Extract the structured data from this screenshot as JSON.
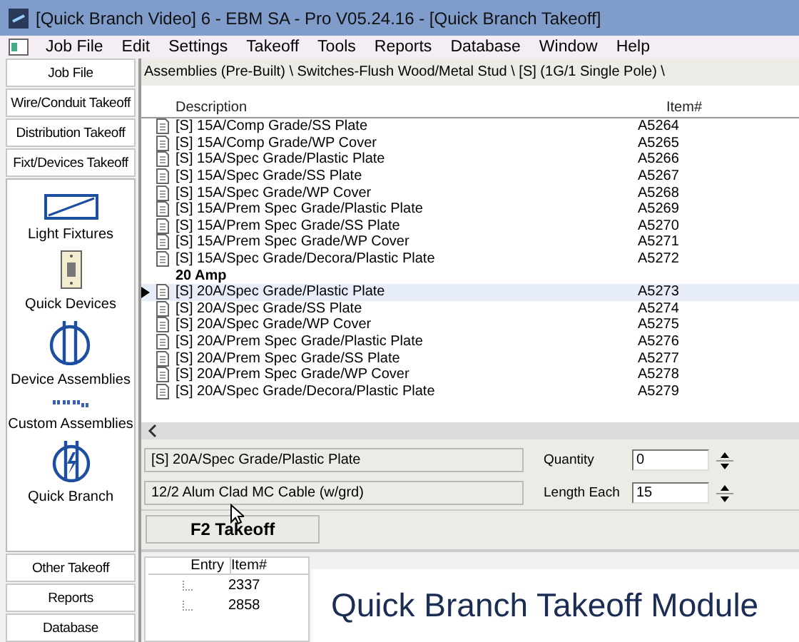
{
  "window": {
    "title": "[Quick Branch Video] 6 - EBM SA  - Pro V05.24.16 - [Quick Branch Takeoff]"
  },
  "menu": [
    "Job File",
    "Edit",
    "Settings",
    "Takeoff",
    "Tools",
    "Reports",
    "Database",
    "Window",
    "Help"
  ],
  "sidebar": {
    "top_buttons": [
      "Job File",
      "Wire/Conduit Takeoff",
      "Distribution Takeoff",
      "Fixt/Devices Takeoff"
    ],
    "tools": [
      {
        "kind": "fixture",
        "label": "Light Fixtures"
      },
      {
        "kind": "device",
        "label": "Quick Devices"
      },
      {
        "kind": "assembly",
        "label": "Device Assemblies"
      },
      {
        "kind": "custom",
        "label": "Custom Assemblies"
      },
      {
        "kind": "branch",
        "label": "Quick Branch"
      }
    ],
    "bottom_buttons": [
      "Other Takeoff",
      "Reports",
      "Database"
    ]
  },
  "breadcrumb": "Assemblies (Pre-Built) \\ Switches-Flush Wood/Metal Stud \\ [S]   (1G/1 Single Pole) \\",
  "table": {
    "columns": [
      "Description",
      "Item#"
    ],
    "rows": [
      {
        "kind": "item",
        "description": "[S] 15A/Comp Grade/SS Plate",
        "item": "A5264",
        "selected": false
      },
      {
        "kind": "item",
        "description": "[S] 15A/Comp Grade/WP Cover",
        "item": "A5265",
        "selected": false
      },
      {
        "kind": "item",
        "description": "[S] 15A/Spec Grade/Plastic Plate",
        "item": "A5266",
        "selected": false
      },
      {
        "kind": "item",
        "description": "[S] 15A/Spec Grade/SS Plate",
        "item": "A5267",
        "selected": false
      },
      {
        "kind": "item",
        "description": "[S] 15A/Spec Grade/WP Cover",
        "item": "A5268",
        "selected": false
      },
      {
        "kind": "item",
        "description": "[S] 15A/Prem Spec Grade/Plastic Plate",
        "item": "A5269",
        "selected": false
      },
      {
        "kind": "item",
        "description": "[S] 15A/Prem Spec Grade/SS Plate",
        "item": "A5270",
        "selected": false
      },
      {
        "kind": "item",
        "description": "[S] 15A/Prem Spec Grade/WP Cover",
        "item": "A5271",
        "selected": false
      },
      {
        "kind": "item",
        "description": "[S] 15A/Spec Grade/Decora/Plastic Plate",
        "item": "A5272",
        "selected": false
      },
      {
        "kind": "group",
        "description": "20 Amp"
      },
      {
        "kind": "item",
        "description": "[S] 20A/Spec Grade/Plastic Plate",
        "item": "A5273",
        "selected": true
      },
      {
        "kind": "item",
        "description": "[S] 20A/Spec Grade/SS Plate",
        "item": "A5274",
        "selected": false
      },
      {
        "kind": "item",
        "description": "[S] 20A/Spec Grade/WP Cover",
        "item": "A5275",
        "selected": false
      },
      {
        "kind": "item",
        "description": "[S] 20A/Prem Spec Grade/Plastic Plate",
        "item": "A5276",
        "selected": false
      },
      {
        "kind": "item",
        "description": "[S] 20A/Prem Spec Grade/SS Plate",
        "item": "A5277",
        "selected": false
      },
      {
        "kind": "item",
        "description": "[S] 20A/Prem Spec Grade/WP Cover",
        "item": "A5278",
        "selected": false
      },
      {
        "kind": "item",
        "description": "[S] 20A/Spec Grade/Decora/Plastic Plate",
        "item": "A5279",
        "selected": false
      }
    ]
  },
  "details": {
    "assembly": "[S] 20A/Spec Grade/Plastic Plate",
    "cable": "12/2 Alum  Clad MC Cable (w/grd)",
    "quantity": {
      "label": "Quantity",
      "value": "0"
    },
    "length": {
      "label": "Length Each",
      "value": "15"
    }
  },
  "takeoff_button": "F2 Takeoff",
  "entries": {
    "columns": [
      "Entry",
      "Item#"
    ],
    "rows": [
      "2337",
      "2858"
    ]
  },
  "caption": "Quick Branch Takeoff Module"
}
